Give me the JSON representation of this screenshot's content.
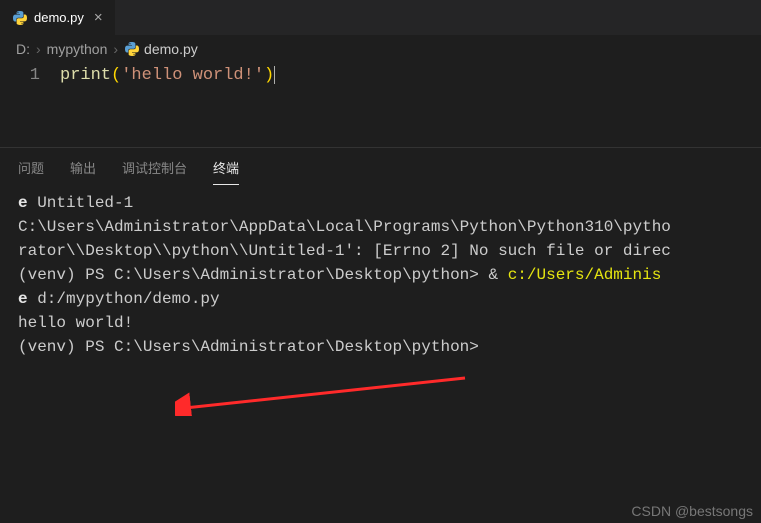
{
  "tab": {
    "filename": "demo.py"
  },
  "breadcrumb": {
    "drive": "D:",
    "folder": "mypython",
    "file": "demo.py"
  },
  "editor": {
    "lineno": "1",
    "fn": "print",
    "lpar": "(",
    "str": "'hello world!'",
    "rpar": ")"
  },
  "panel": {
    "tabs": {
      "problems": "问题",
      "output": "输出",
      "debug": "调试控制台",
      "terminal": "终端"
    }
  },
  "terminal": {
    "l1a": "e ",
    "l1b": "Untitled-1",
    "l2": "C:\\Users\\Administrator\\AppData\\Local\\Programs\\Python\\Python310\\pytho",
    "l3": "rator\\\\Desktop\\\\python\\\\Untitled-1': [Errno 2] No such file or direc",
    "l4a": "(venv) PS C:\\Users\\Administrator\\Desktop\\python> & ",
    "l4b": "c:/Users/Adminis",
    "l5a": "e ",
    "l5b": "d:/mypython/demo.py",
    "l6": "hello world!",
    "l7": "(venv) PS C:\\Users\\Administrator\\Desktop\\python>"
  },
  "watermark": "CSDN @bestsongs"
}
